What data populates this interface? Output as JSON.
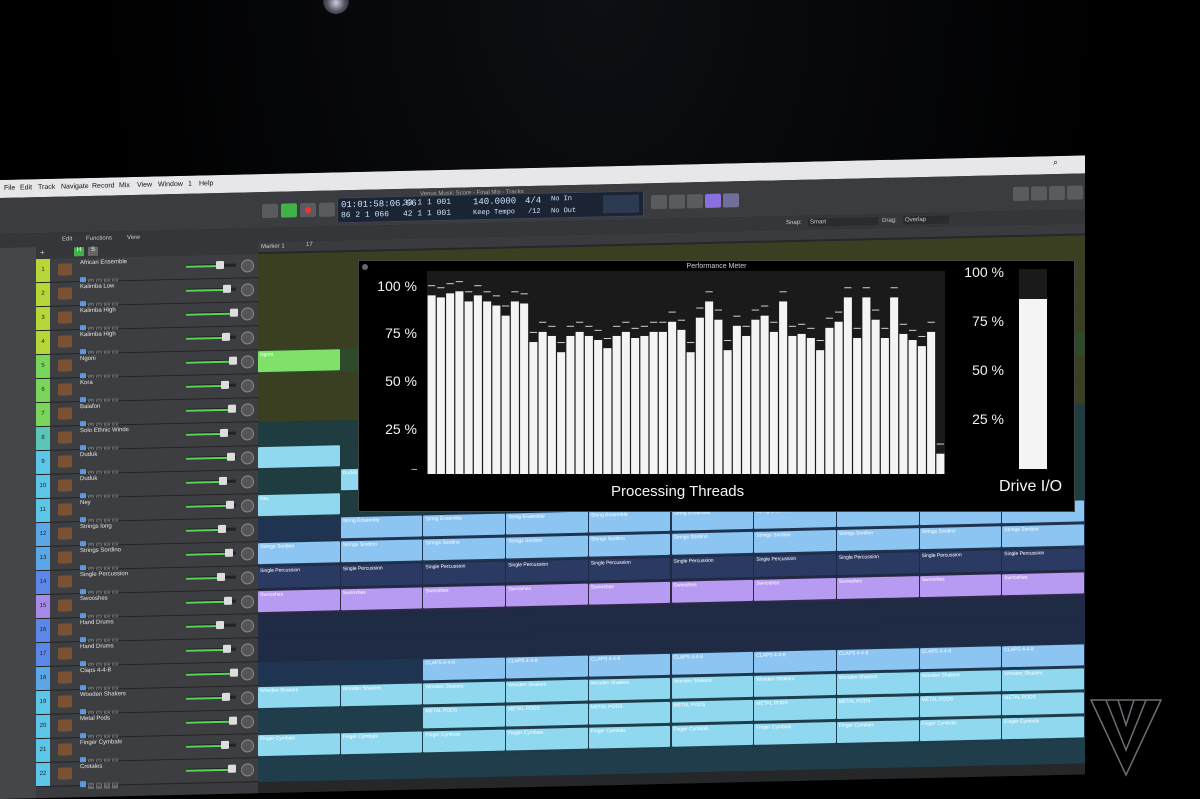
{
  "menubar": {
    "items": [
      "File",
      "Edit",
      "Track",
      "Navigate",
      "Record",
      "Mix",
      "View",
      "Window",
      "1",
      "Help"
    ]
  },
  "window": {
    "title": "Venus Music Score - Final Mix - Tracks"
  },
  "lcd": {
    "time": "01:01:58:06.66",
    "bars": "33  1  1  001",
    "bars2": "86  2  1  066",
    "bars3": "42  1  1  001",
    "tempo": "140.0000",
    "tempo_label": "Keep Tempo",
    "signature": "4/4",
    "division": "/12",
    "in": "No In",
    "out": "No Out"
  },
  "toolbar": {
    "edit": "Edit",
    "functions": "Functions",
    "view": "View",
    "snap_label": "Snap:",
    "snap_value": "Smart",
    "drag_label": "Drag:",
    "drag_value": "Overlap",
    "m_label": "M",
    "s_label": "S",
    "ruler_17": "17",
    "ruler_marker": "Marker 1"
  },
  "tracks": [
    {
      "num": "1",
      "name": "African Ensemble",
      "color": "#b7d63a"
    },
    {
      "num": "2",
      "name": "Kalimba Low",
      "color": "#b7d63a"
    },
    {
      "num": "3",
      "name": "Kalimba High",
      "color": "#b7d63a"
    },
    {
      "num": "4",
      "name": "Kalimba High",
      "color": "#b7d63a"
    },
    {
      "num": "5",
      "name": "Ngoni",
      "color": "#7ad65a"
    },
    {
      "num": "6",
      "name": "Kora",
      "color": "#7ad65a"
    },
    {
      "num": "7",
      "name": "Balafon",
      "color": "#7ad65a"
    },
    {
      "num": "8",
      "name": "Solo Ethnic Winds",
      "color": "#5bc6b8"
    },
    {
      "num": "9",
      "name": "Duduk",
      "color": "#5bc6e8"
    },
    {
      "num": "10",
      "name": "Duduk",
      "color": "#5bc6e8"
    },
    {
      "num": "11",
      "name": "Ney",
      "color": "#5bc6e8"
    },
    {
      "num": "12",
      "name": "Strings long",
      "color": "#5ba8e8"
    },
    {
      "num": "13",
      "name": "Strings Sordino",
      "color": "#5ba8e8"
    },
    {
      "num": "14",
      "name": "Single Percussion",
      "color": "#5b88e8"
    },
    {
      "num": "15",
      "name": "Swooshes",
      "color": "#a58ae8"
    },
    {
      "num": "16",
      "name": "Hand Drums",
      "color": "#5b88e8"
    },
    {
      "num": "17",
      "name": "Hand Drums",
      "color": "#5b88e8"
    },
    {
      "num": "18",
      "name": "Claps 4-4-8",
      "color": "#5ba8e8"
    },
    {
      "num": "19",
      "name": "Wooden Shakers",
      "color": "#5bc6e8"
    },
    {
      "num": "20",
      "name": "Metal Pods",
      "color": "#5bc6e8"
    },
    {
      "num": "21",
      "name": "Finger Cymbals",
      "color": "#5bc6e8"
    },
    {
      "num": "22",
      "name": "Crotales",
      "color": "#5bc6e8"
    }
  ],
  "regions": [
    {
      "lane": 4,
      "label": "Ngoni",
      "start": 0,
      "end": 1,
      "color": "#7fe06a"
    },
    {
      "lane": 8,
      "label": "",
      "start": 0,
      "end": 1,
      "color": "#8fd8f0"
    },
    {
      "lane": 9,
      "label": "Duduk",
      "start": 1,
      "end": 2,
      "color": "#8fd8f0"
    },
    {
      "lane": 10,
      "label": "Ney",
      "start": 0,
      "end": 1,
      "color": "#8fd8f0"
    },
    {
      "lane": 11,
      "label": "String Ensemble",
      "start": 1,
      "end": 10,
      "color": "#8cc4f2"
    },
    {
      "lane": 12,
      "label": "Strings Sordino",
      "start": 0,
      "end": 10,
      "color": "#8cc4f2"
    },
    {
      "lane": 13,
      "label": "Single Percussion",
      "start": 0,
      "end": 10,
      "color": "#2b3a63"
    },
    {
      "lane": 14,
      "label": "Swooshes",
      "start": 0,
      "end": 10,
      "color": "#b79af2"
    },
    {
      "lane": 17,
      "label": "CLAPS 4-4-8",
      "start": 2,
      "end": 10,
      "color": "#8cc4f2"
    },
    {
      "lane": 18,
      "label": "Wooden Shakers",
      "start": 0,
      "end": 10,
      "color": "#8fd8f0"
    },
    {
      "lane": 19,
      "label": "METAL PODS",
      "start": 2,
      "end": 10,
      "color": "#8fd8f0"
    },
    {
      "lane": 20,
      "label": "Finger Cymbals",
      "start": 0,
      "end": 10,
      "color": "#8fd8f0"
    }
  ],
  "performance_meter": {
    "title": "Performance Meter",
    "thread_ticks": [
      "100 %",
      "75 %",
      "50 %",
      "25 %",
      "–"
    ],
    "io_ticks": [
      "100 %",
      "75 %",
      "50 %",
      "25 %"
    ],
    "threads_label": "Processing Threads",
    "io_label": "Drive I/O",
    "threads": [
      88,
      87,
      89,
      90,
      85,
      88,
      85,
      83,
      78,
      85,
      84,
      65,
      70,
      68,
      60,
      68,
      70,
      68,
      66,
      62,
      68,
      70,
      67,
      68,
      70,
      70,
      75,
      71,
      60,
      77,
      85,
      76,
      61,
      73,
      68,
      76,
      78,
      70,
      85,
      68,
      69,
      67,
      61,
      72,
      75,
      87,
      67,
      87,
      76,
      67,
      87,
      69,
      66,
      63,
      70,
      10
    ],
    "drive_io": 85
  },
  "colors": {
    "accent": "#5b9ae0",
    "meter_bar": "#f4f4f4",
    "meter_bg": "#1a1a1a"
  }
}
